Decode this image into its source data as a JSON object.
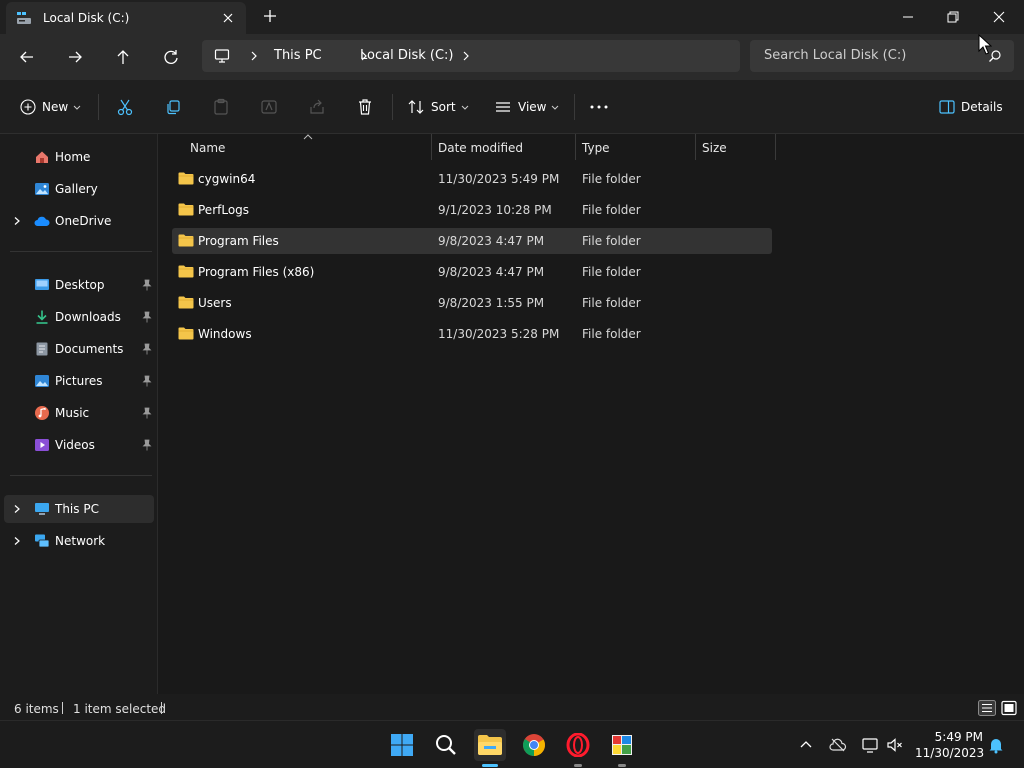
{
  "window": {
    "tab_title": "Local Disk (C:)",
    "search_placeholder": "Search Local Disk (C:)"
  },
  "breadcrumb": [
    "This PC",
    "Local Disk (C:)"
  ],
  "commands": {
    "new": "New",
    "sort": "Sort",
    "view": "View",
    "details": "Details"
  },
  "sidebar": {
    "top": [
      {
        "label": "Home"
      },
      {
        "label": "Gallery"
      },
      {
        "label": "OneDrive"
      }
    ],
    "quick": [
      {
        "label": "Desktop"
      },
      {
        "label": "Downloads"
      },
      {
        "label": "Documents"
      },
      {
        "label": "Pictures"
      },
      {
        "label": "Music"
      },
      {
        "label": "Videos"
      }
    ],
    "bottom": [
      {
        "label": "This PC"
      },
      {
        "label": "Network"
      }
    ]
  },
  "columns": {
    "name": "Name",
    "date": "Date modified",
    "type": "Type",
    "size": "Size"
  },
  "files": [
    {
      "name": "cygwin64",
      "date": "11/30/2023 5:49 PM",
      "type": "File folder"
    },
    {
      "name": "PerfLogs",
      "date": "9/1/2023 10:28 PM",
      "type": "File folder"
    },
    {
      "name": "Program Files",
      "date": "9/8/2023 4:47 PM",
      "type": "File folder"
    },
    {
      "name": "Program Files (x86)",
      "date": "9/8/2023 4:47 PM",
      "type": "File folder"
    },
    {
      "name": "Users",
      "date": "9/8/2023 1:55 PM",
      "type": "File folder"
    },
    {
      "name": "Windows",
      "date": "11/30/2023 5:28 PM",
      "type": "File folder"
    }
  ],
  "status": {
    "count": "6 items",
    "selected": "1 item selected"
  },
  "clock": {
    "time": "5:49 PM",
    "date": "11/30/2023"
  },
  "colors": {
    "folder": "#f4c54a",
    "accent": "#4cc2ff"
  }
}
